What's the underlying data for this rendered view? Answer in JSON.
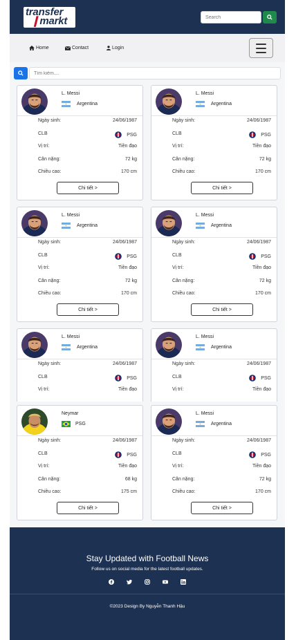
{
  "header": {
    "logo_line1": "transfer",
    "logo_line2": "markt",
    "search_placeholder": "Search",
    "bg_color": "#1d3152"
  },
  "nav": {
    "home": "Home",
    "contact": "Contact",
    "login": "Login"
  },
  "search": {
    "placeholder": "Tìm kiếm...."
  },
  "labels": {
    "birth": "Ngày sinh:",
    "club": "CLB",
    "position": "Vị trí:",
    "weight": "Cân nặng:",
    "height": "Chiều cao:",
    "detail": "Chi tiết >"
  },
  "players": [
    {
      "name": "L. Messi",
      "nation": "Argentina",
      "birth": "24/06/1987",
      "club": "PSG",
      "position": "Tiền đạo",
      "weight": "72 kg",
      "height": "170 cm"
    },
    {
      "name": "L. Messi",
      "nation": "Argentina",
      "birth": "24/06/1987",
      "club": "PSG",
      "position": "Tiền đạo",
      "weight": "72 kg",
      "height": "170 cm"
    },
    {
      "name": "L. Messi",
      "nation": "Argentina",
      "birth": "24/06/1987",
      "club": "PSG",
      "position": "Tiền đạo",
      "weight": "72 kg",
      "height": "170 cm"
    },
    {
      "name": "L. Messi",
      "nation": "Argentina",
      "birth": "24/06/1987",
      "club": "PSG",
      "position": "Tiền đạo",
      "weight": "72 kg",
      "height": "170 cm"
    },
    {
      "name": "L. Messi",
      "nation": "Argentina",
      "birth": "24/06/1987",
      "club": "PSG",
      "position": "Tiền đạo"
    },
    {
      "name": "L. Messi",
      "nation": "Argentina",
      "birth": "24/06/1987",
      "club": "PSG",
      "position": "Tiền đạo"
    },
    {
      "name": "Neymar",
      "nation": "PSG",
      "birth": "24/06/1987",
      "club": "PSG",
      "position": "Tiền đạo",
      "weight": "68 kg",
      "height": "175 cm"
    },
    {
      "name": "L. Messi",
      "nation": "Argentina",
      "birth": "24/06/1987",
      "club": "PSG",
      "position": "Tiền đạo",
      "weight": "72 kg",
      "height": "170 cm"
    }
  ],
  "footer": {
    "title": "Stay Updated with Football News",
    "subtitle": "Follow us on social media for the latest football updates.",
    "copyright": "©2023 Design By Nguyễn Thanh Hậu",
    "icons": [
      "facebook-icon",
      "twitter-icon",
      "instagram-icon",
      "youtube-icon",
      "linkedin-icon"
    ]
  },
  "colors": {
    "navy": "#1d3152",
    "search_green": "#1f8a4c",
    "search_blue": "#1a73e8"
  }
}
